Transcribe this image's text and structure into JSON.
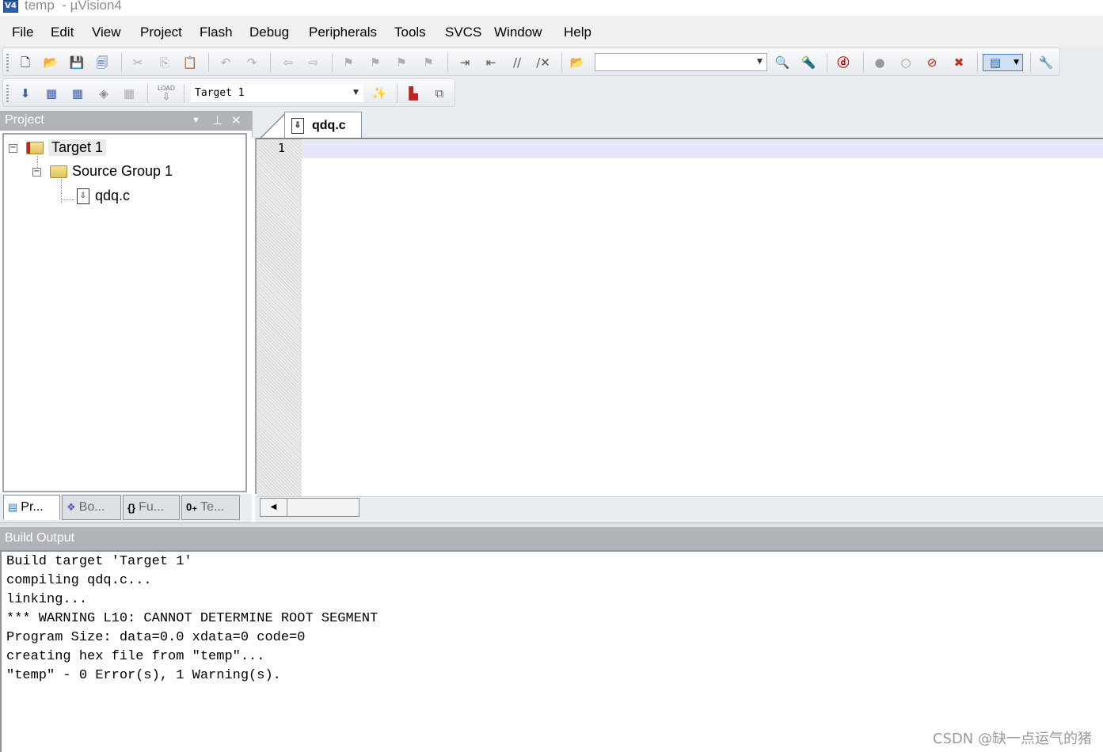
{
  "window": {
    "title": "temp  - µVision4",
    "app_icon": "V4"
  },
  "menu": [
    "File",
    "Edit",
    "View",
    "Project",
    "Flash",
    "Debug",
    "Peripherals",
    "Tools",
    "SVCS",
    "Window",
    "Help"
  ],
  "toolbar": {
    "find_combo_value": "",
    "target_combo_value": "Target 1",
    "load_label": "LOAD"
  },
  "project_panel": {
    "title": "Project",
    "tree": {
      "target": "Target 1",
      "group": "Source Group 1",
      "file": "qdq.c"
    },
    "tabs": [
      "Pr...",
      "Bo...",
      "Fu...",
      "Te..."
    ]
  },
  "editor": {
    "tab_label": "qdq.c",
    "line_numbers": [
      "1"
    ]
  },
  "build_output": {
    "title": "Build Output",
    "lines": [
      "Build target 'Target 1'",
      "compiling qdq.c...",
      "linking...",
      "*** WARNING L10: CANNOT DETERMINE ROOT SEGMENT",
      "Program Size: data=0.0 xdata=0 code=0",
      "creating hex file from \"temp\"...",
      "\"temp\" - 0 Error(s), 1 Warning(s)."
    ]
  },
  "watermark": "CSDN @缺一点运气的猪"
}
